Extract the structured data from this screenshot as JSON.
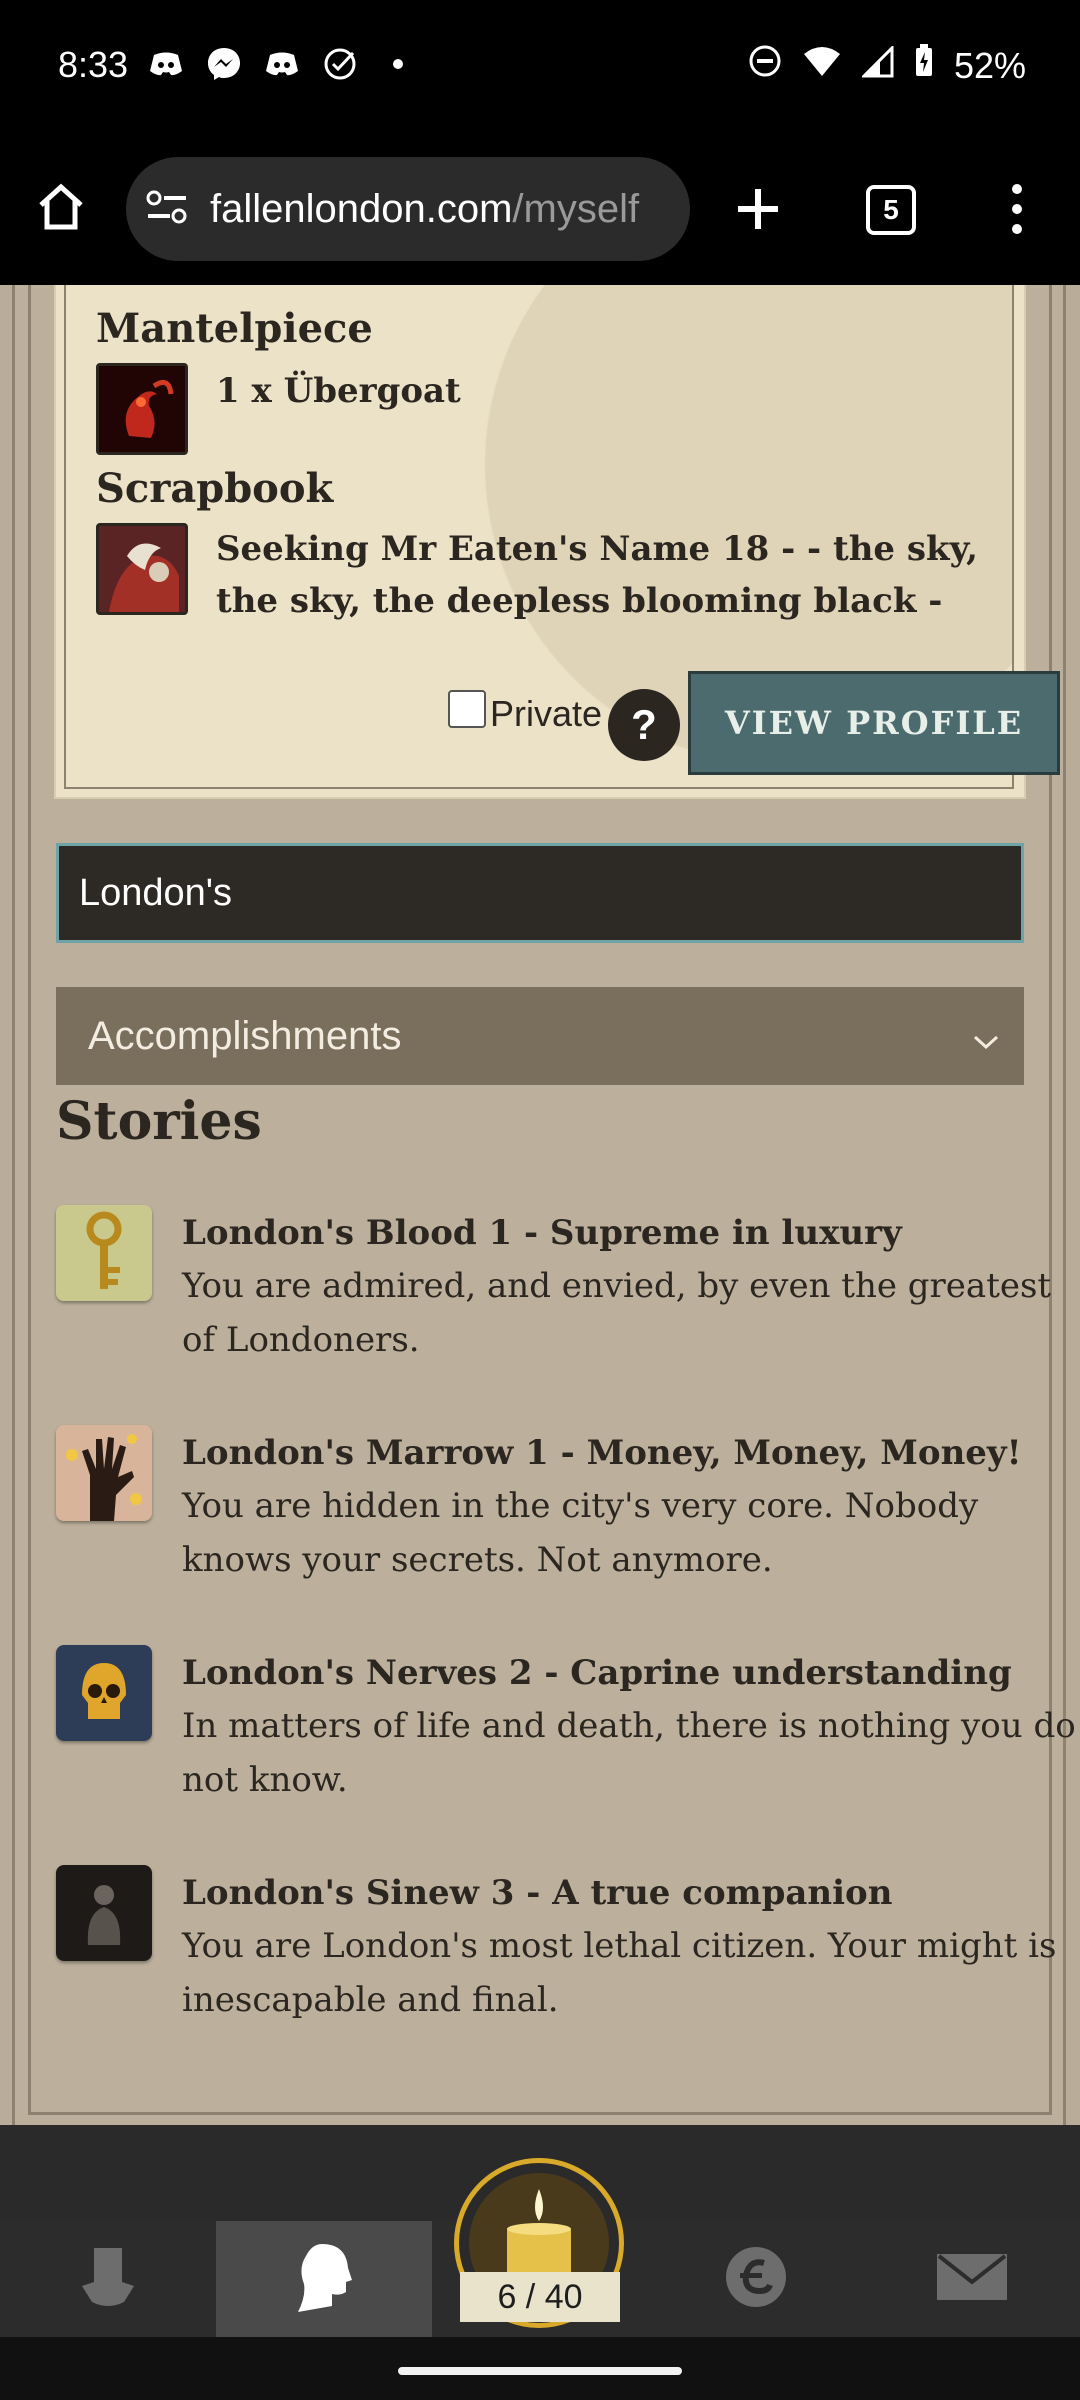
{
  "status_bar": {
    "time": "8:33",
    "battery": "52%"
  },
  "browser": {
    "url_main": "fallenlondon.com",
    "url_dim": "/myself",
    "tab_count": "5"
  },
  "profile": {
    "mantelpiece_title": "Mantelpiece",
    "mantelpiece_item": "1 x Übergoat",
    "scrapbook_title": "Scrapbook",
    "scrapbook_item": "Seeking Mr Eaten's Name 18 - - the sky, the sky, the deepless blooming black -",
    "private_label": "Private",
    "help_label": "?",
    "view_profile_label": "VIEW PROFILE"
  },
  "search": {
    "value": "London's"
  },
  "accordion": {
    "label": "Accomplishments"
  },
  "stories": {
    "title": "Stories",
    "items": [
      {
        "title": "London's Blood 1 - Supreme in luxury",
        "desc": "You are admired, and envied, by even the greatest of Londoners."
      },
      {
        "title": "London's Marrow 1 - Money, Money, Money!",
        "desc": "You are hidden in the city's very core. Nobody knows your secrets. Not anymore."
      },
      {
        "title": "London's Nerves 2 - Caprine understanding",
        "desc": "In matters of life and death, there is nothing you do not know."
      },
      {
        "title": "London's Sinew 3 - A true companion",
        "desc": "You are London's most lethal citizen. Your might is inescapable and final."
      }
    ]
  },
  "bottom_nav": {
    "actions": "6 / 40"
  }
}
